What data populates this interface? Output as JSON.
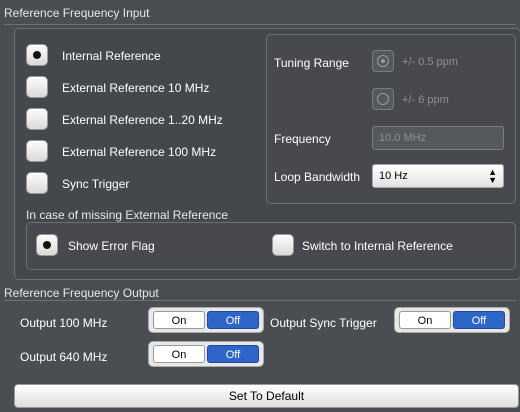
{
  "input_section": {
    "title": "Reference Frequency Input",
    "options": [
      {
        "label": "Internal Reference",
        "selected": true
      },
      {
        "label": "External Reference 10 MHz",
        "selected": false
      },
      {
        "label": "External Reference 1..20 MHz",
        "selected": false
      },
      {
        "label": "External Reference 100 MHz",
        "selected": false
      },
      {
        "label": "Sync Trigger",
        "selected": false
      }
    ],
    "tuning_range": {
      "label": "Tuning Range",
      "option1": "+/- 0.5 ppm",
      "option2": "+/- 6 ppm",
      "selected": "option1"
    },
    "frequency": {
      "label": "Frequency",
      "value": "10.0 MHz"
    },
    "loop_bandwidth": {
      "label": "Loop Bandwidth",
      "value": "10 Hz"
    },
    "missing_ref": {
      "title": "In case of missing External Reference",
      "show_error": "Show Error Flag",
      "switch_internal": "Switch to Internal Reference",
      "selected": "show_error"
    }
  },
  "output_section": {
    "title": "Reference Frequency Output",
    "out100": {
      "label": "Output 100 MHz",
      "on": "On",
      "off": "Off",
      "state": "off"
    },
    "out640": {
      "label": "Output 640 MHz",
      "on": "On",
      "off": "Off",
      "state": "off"
    },
    "sync": {
      "label": "Output Sync Trigger",
      "on": "On",
      "off": "Off",
      "state": "off"
    }
  },
  "default_button": "Set To Default",
  "colors": {
    "background": "#4a4d52",
    "active_toggle": "#2e65c8",
    "text": "#ffffff"
  }
}
